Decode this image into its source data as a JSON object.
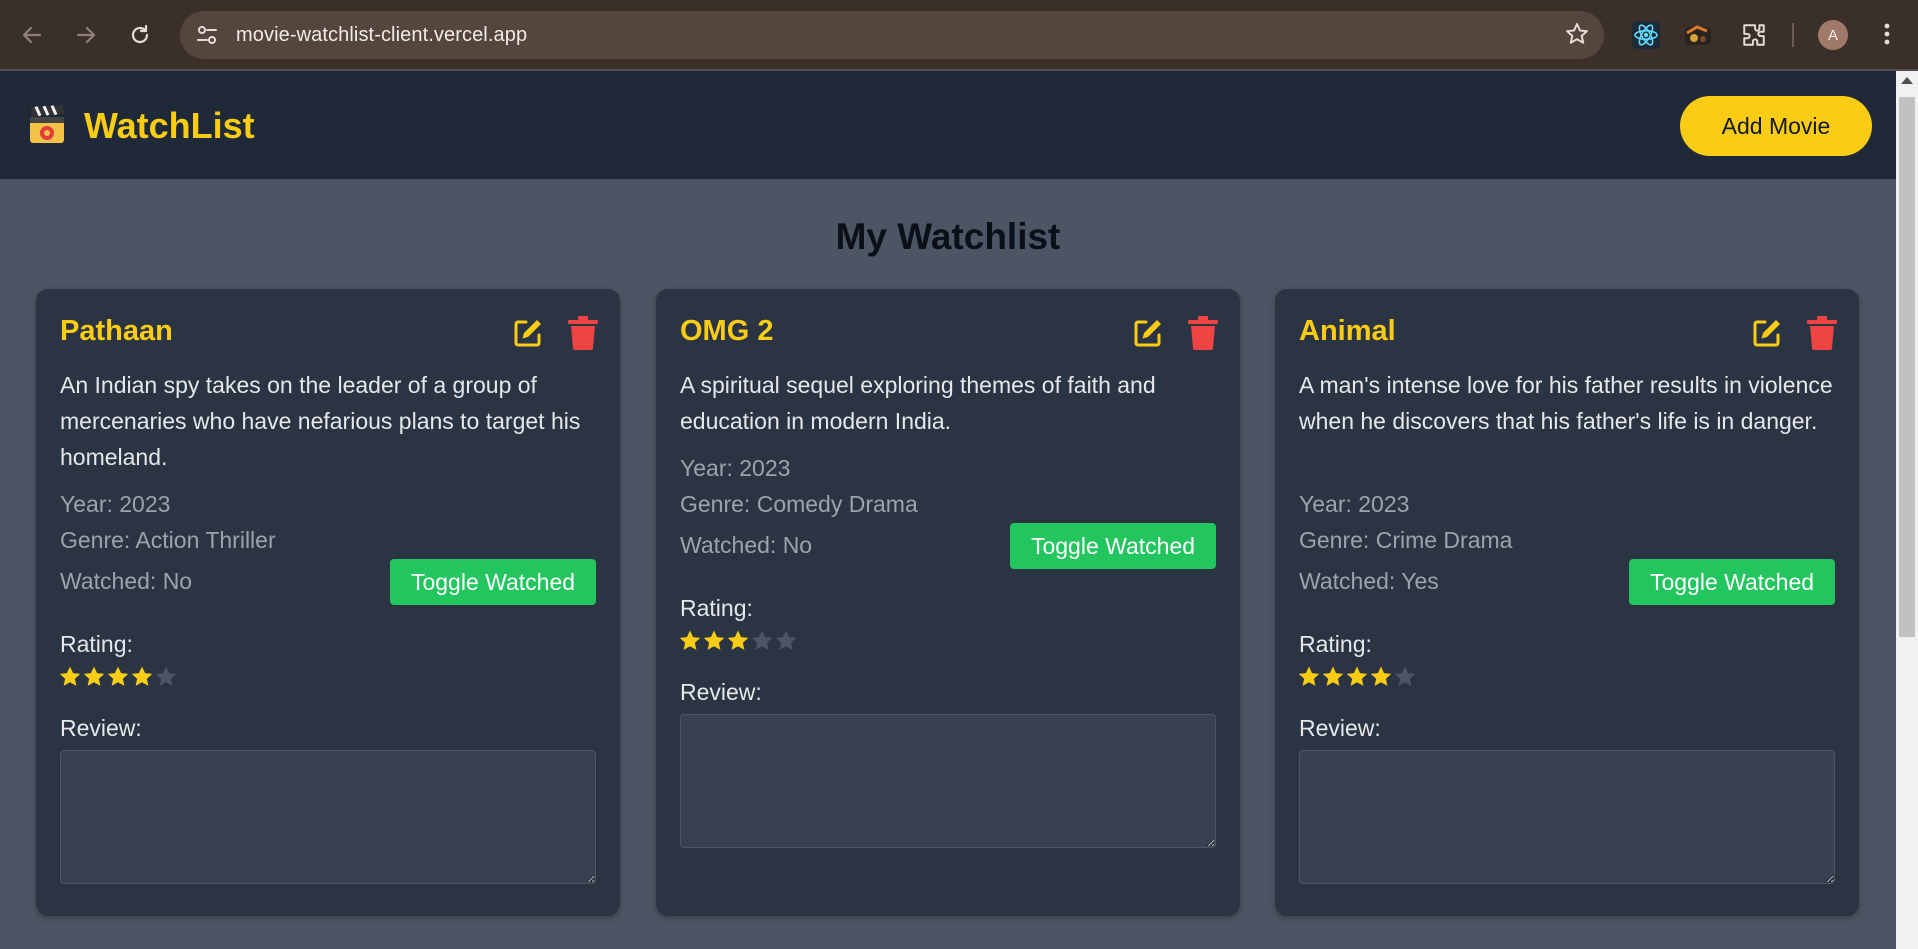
{
  "browser": {
    "url": "movie-watchlist-client.vercel.app",
    "avatar_letter": "A"
  },
  "header": {
    "logo_icon": "clapperboard-icon",
    "title": "WatchList",
    "add_button_label": "Add Movie"
  },
  "main": {
    "title": "My Watchlist"
  },
  "labels": {
    "toggle_button": "Toggle Watched",
    "rating": "Rating:",
    "review": "Review:"
  },
  "movies": [
    {
      "title": "Pathaan",
      "description": "An Indian spy takes on the leader of a group of mercenaries who have nefarious plans to target his homeland.",
      "year": "Year: 2023",
      "genre": "Genre: Action Thriller",
      "watched": "Watched: No",
      "rating": 4,
      "max_rating": 5,
      "review": ""
    },
    {
      "title": "OMG 2",
      "description": "A spiritual sequel exploring themes of faith and education in modern India.",
      "year": "Year: 2023",
      "genre": "Genre: Comedy Drama",
      "watched": "Watched: No",
      "rating": 3,
      "max_rating": 5,
      "review": ""
    },
    {
      "title": "Animal",
      "description": "A man's intense love for his father results in violence when he discovers that his father's life is in danger.",
      "year": "Year: 2023",
      "genre": "Genre: Crime Drama",
      "watched": "Watched: Yes",
      "rating": 4,
      "max_rating": 5,
      "review": ""
    }
  ],
  "colors": {
    "accent": "#facc15",
    "toggle": "#22c55e",
    "delete": "#ef4444",
    "star_empty": "#4b5563",
    "card_bg": "#2b3442",
    "header_bg": "#1f2937",
    "page_bg": "#4b5563"
  }
}
